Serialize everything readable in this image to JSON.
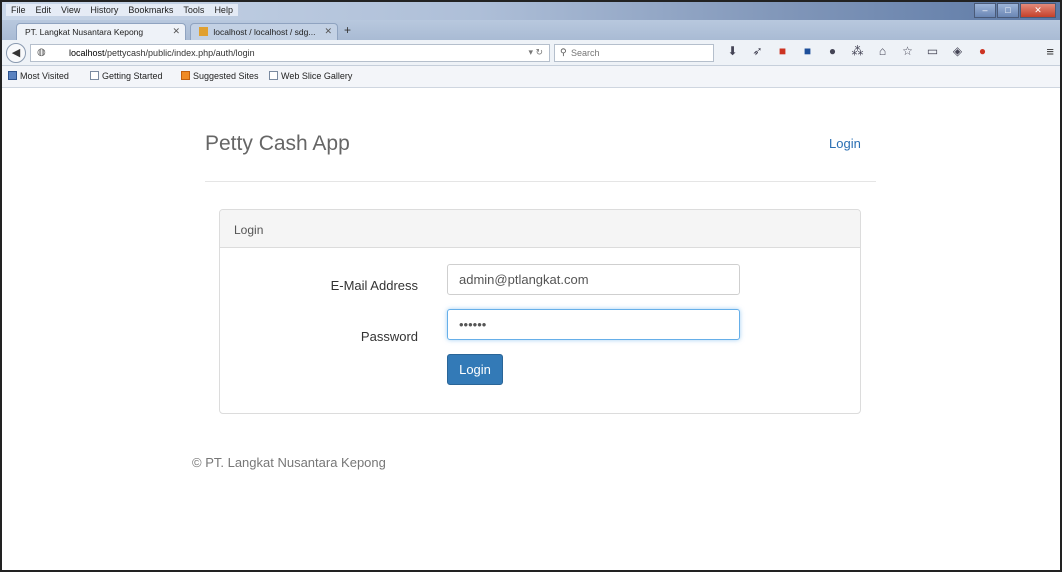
{
  "browser": {
    "menu": [
      "File",
      "Edit",
      "View",
      "History",
      "Bookmarks",
      "Tools",
      "Help"
    ],
    "tabs": [
      {
        "label": "PT. Langkat Nusantara Kepong",
        "active": true
      },
      {
        "label": "localhost / localhost / sdg...",
        "active": false
      }
    ],
    "url_host": "localhost",
    "url_path": "/pettycash/public/index.php/auth/login",
    "search_placeholder": "Search",
    "bookmarks": [
      "Most Visited",
      "Getting Started",
      "Suggested Sites",
      "Web Slice Gallery"
    ],
    "icons": {
      "back": "back-arrow-icon",
      "download": "download-icon",
      "home": "home-icon",
      "star": "bookmark-star-icon",
      "menu": "hamburger-menu-icon"
    }
  },
  "app": {
    "brand": "Petty Cash App",
    "nav_login": "Login",
    "accent_color": "#337ab7"
  },
  "login_panel": {
    "heading": "Login",
    "email_label": "E-Mail Address",
    "email_value": "admin@ptlangkat.com",
    "password_label": "Password",
    "password_value": "••••••",
    "submit_label": "Login"
  },
  "footer": {
    "text": "© PT. Langkat Nusantara Kepong"
  }
}
